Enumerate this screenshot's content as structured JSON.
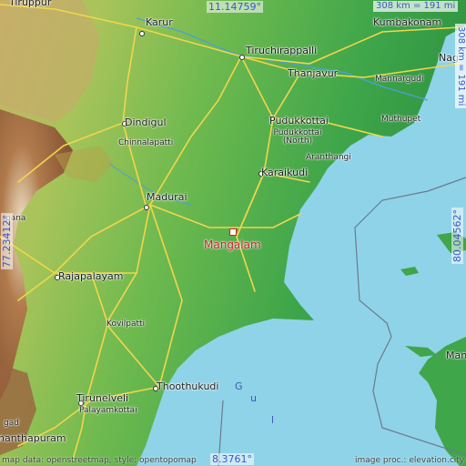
{
  "map": {
    "target": {
      "name": "Mangalam"
    },
    "cities": [
      {
        "id": "tiruppur",
        "name": "Tiruppur",
        "size": "lg"
      },
      {
        "id": "karur",
        "name": "Karur",
        "size": "lg"
      },
      {
        "id": "kumbakonam",
        "name": "Kumbakonam",
        "size": "lg"
      },
      {
        "id": "tiruchirappalli",
        "name": "Tiruchirappalli",
        "size": "lg"
      },
      {
        "id": "nagapattinam",
        "name": "Nag",
        "size": "lg"
      },
      {
        "id": "thanjavur",
        "name": "Thanjavur",
        "size": "lg"
      },
      {
        "id": "mannargudi",
        "name": "Mannargudi",
        "size": "sm"
      },
      {
        "id": "dindigul",
        "name": "Dindigul",
        "size": "lg"
      },
      {
        "id": "pudukkottai",
        "name": "Pudukkottai",
        "size": "lg"
      },
      {
        "id": "pudukkottai_north",
        "name": "Pudukkottai (North)",
        "size": "sm"
      },
      {
        "id": "muthupet",
        "name": "Muthupet",
        "size": "sm"
      },
      {
        "id": "chinnalapatti",
        "name": "Chinnalapatti",
        "size": "sm"
      },
      {
        "id": "aranthangi",
        "name": "Aranthangi",
        "size": "sm"
      },
      {
        "id": "karaikudi",
        "name": "Karaikudi",
        "size": "lg"
      },
      {
        "id": "madurai",
        "name": "Madurai",
        "size": "lg"
      },
      {
        "id": "rajapalayam",
        "name": "Rajapalayam",
        "size": "lg"
      },
      {
        "id": "kovilpatti",
        "name": "Kovilpatti",
        "size": "sm"
      },
      {
        "id": "thoothukudi",
        "name": "Thoothukudi",
        "size": "lg"
      },
      {
        "id": "tirunelveli",
        "name": "Tirunelveli",
        "size": "lg"
      },
      {
        "id": "palayamkottai",
        "name": "Palayamkottai",
        "size": "sm"
      },
      {
        "id": "nanthapuram",
        "name": "nanthapuram",
        "size": "lg"
      },
      {
        "id": "pana",
        "name": "pana",
        "size": "sm"
      },
      {
        "id": "gadag",
        "name": "gad",
        "size": "sm"
      },
      {
        "id": "mannar",
        "name": "Man",
        "size": "lg"
      }
    ],
    "coords": {
      "top": "11.14759°",
      "bottom": "8.3761°",
      "left": "77.23412°",
      "right": "80.04562°"
    },
    "scale": {
      "top": "308 km = 191 mi",
      "right": "308 km = 191 mi"
    },
    "sea_label_letters": [
      "G",
      "u",
      "l"
    ],
    "credits": {
      "left": "map data: openstreetmap, style: opentopomap",
      "right": "image proc.: elevation.city"
    },
    "colors": {
      "sea": "#8fd3e8",
      "lowland": "#4caf50",
      "highland": "#b8a24a",
      "mountain": "#8b5a3c",
      "road": "#f2d64b",
      "target": "#d0202a",
      "coords": "#3b57c8"
    }
  }
}
